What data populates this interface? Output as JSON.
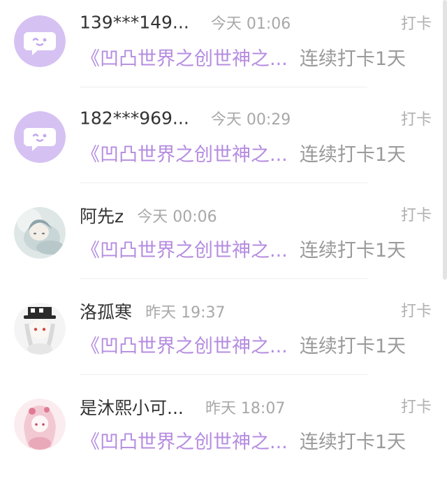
{
  "tag_label": "打卡",
  "work_title": "《凹凸世界之创世神之...",
  "streak_text": "连续打卡1天",
  "items": [
    {
      "name": "139***149...",
      "time": "今天 01:06",
      "avatar": "chat-bubble-default-icon"
    },
    {
      "name": "182***969...",
      "time": "今天 00:29",
      "avatar": "chat-bubble-default-icon"
    },
    {
      "name": "阿先z",
      "time": "今天 00:06",
      "avatar": "user-avatar-photo"
    },
    {
      "name": "洛孤寒",
      "time": "昨天 19:37",
      "avatar": "user-avatar-photo"
    },
    {
      "name": "是沐熙小可...",
      "time": "昨天 18:07",
      "avatar": "user-avatar-photo"
    }
  ],
  "colors": {
    "accent_purple": "#b58ce0",
    "default_avatar_bg": "#d6c1f3",
    "meta_gray": "#a8a8a8"
  }
}
